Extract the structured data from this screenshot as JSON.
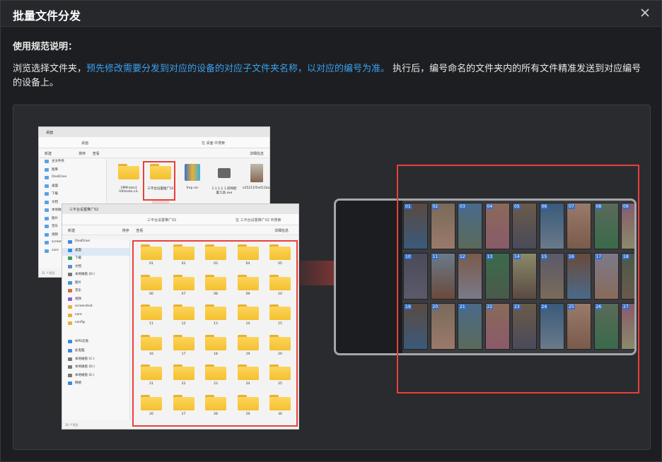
{
  "dialog": {
    "title": "批量文件分发",
    "close_label": "×"
  },
  "instructions": {
    "heading": "使用规范说明：",
    "text_part1": "浏览选择文件夹，",
    "text_highlight": "预先修改需要分发到对应的设备的对应子文件夹名称，以对应的编号为准。",
    "text_part2": "执行后，编号命名的文件夹内的所有文件精准发送到对应编号的设备上。"
  },
  "explorer_back": {
    "tab": "桌面",
    "address": "桌面",
    "search": "在 桌面 中搜索",
    "toolbar_new": "新建",
    "toolbar_sort": "排序",
    "toolbar_view": "查看",
    "toolbar_detail": "详细信息",
    "sidebar": [
      "主文件夹",
      "图库",
      "OneDrive",
      "桌面",
      "下载",
      "文档",
      "本地磁盘 (D:)",
      "图片",
      "音乐",
      "视频",
      "screen",
      "core"
    ],
    "files": [
      "VMProtect Ultimate.v3.6.4 Build 1754",
      "三平台设置推广02",
      "frep.rar",
      "1.1.1.1.1.剪映配置工具.exe",
      "e25211f5e011ba6e65bf14c5ad6513a6060e25ef0597e2bd48e5399.mp4"
    ],
    "status": "21 个项目"
  },
  "explorer_front": {
    "tab": "三平台设置推广02",
    "address": "三平台设置推广02",
    "search": "在 三平台设置推广02 中搜索",
    "toolbar_new": "新建",
    "toolbar_sort": "排序",
    "toolbar_view": "查看",
    "toolbar_detail": "详细信息",
    "sidebar": [
      "OneDrive",
      "桌面",
      "下载",
      "文档",
      "本地磁盘 (D:)",
      "图片",
      "音乐",
      "视频",
      "screenshot",
      "core",
      "config",
      "WPS云盘",
      "此电脑",
      "本地磁盘 (C:)",
      "本地磁盘 (D:)",
      "本地磁盘 (E:)",
      "网络"
    ],
    "sidebar_colors": [
      "#3a8ae0",
      "#3a8ae0",
      "#3aa060",
      "#5a8ad0",
      "#777",
      "#3a9ae0",
      "#e06a3a",
      "#8a5ae0",
      "#e8b032",
      "#e8b032",
      "#e8b032",
      "#3a8ae0",
      "#3a8ae0",
      "#777",
      "#777",
      "#777",
      "#3a8ae0"
    ],
    "folders": [
      "01",
      "02",
      "03",
      "04",
      "05",
      "06",
      "07",
      "08",
      "09",
      "10",
      "11",
      "12",
      "13",
      "14",
      "15",
      "16",
      "17",
      "18",
      "19",
      "20",
      "21",
      "22",
      "23",
      "24",
      "25",
      "26",
      "27",
      "28",
      "29",
      "30"
    ],
    "status": "30 个项目"
  },
  "device_panel": {
    "thumb_numbers": [
      "01",
      "02",
      "03",
      "04",
      "05",
      "06",
      "07",
      "08",
      "09",
      "10",
      "11",
      "12",
      "13",
      "14",
      "15",
      "16",
      "17",
      "18",
      "19",
      "20",
      "21",
      "22",
      "23",
      "24",
      "25",
      "26",
      "27"
    ]
  },
  "colors": {
    "accent_blue": "#3aa0f0",
    "red_box": "#e8403a",
    "folder": "#f4c02f"
  }
}
